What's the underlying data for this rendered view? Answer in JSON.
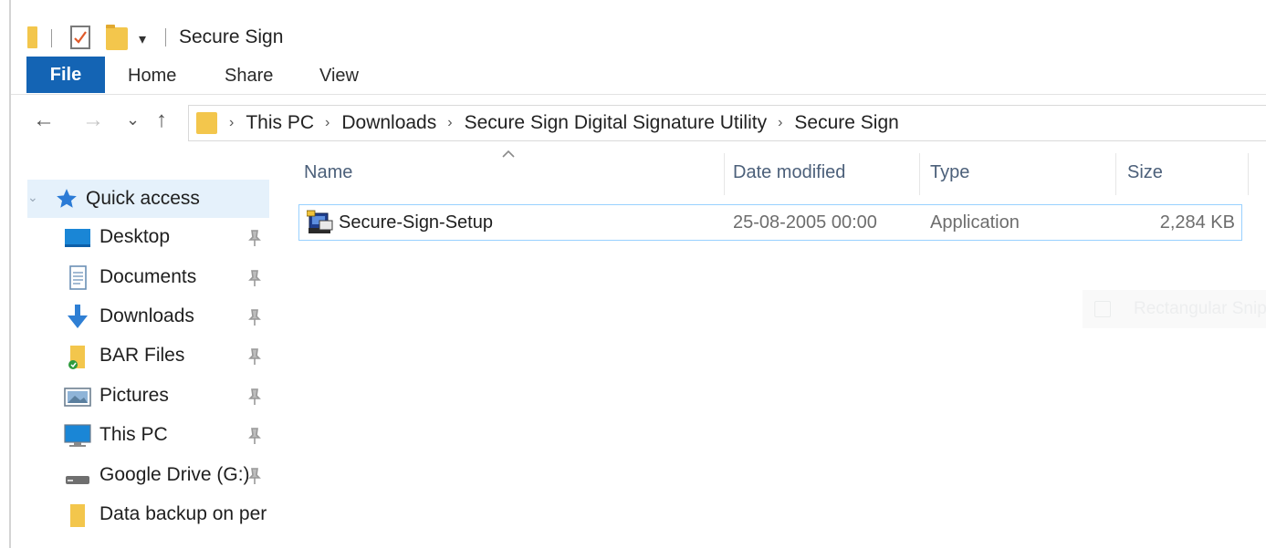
{
  "window": {
    "title": "Secure Sign"
  },
  "quick_toolbar": {
    "dropdown_glyph": "▾"
  },
  "ribbon": {
    "file_tab": "File",
    "tabs": [
      "Home",
      "Share",
      "View"
    ],
    "active_color": "#1464b4"
  },
  "nav_buttons": {
    "back": "←",
    "forward": "→",
    "recent": "⌄",
    "up": "↑"
  },
  "address": {
    "separator": "›",
    "crumbs": [
      "This PC",
      "Downloads",
      "Secure Sign  Digital Signature Utility",
      "Secure Sign"
    ]
  },
  "nav_pane": {
    "quick_access": "Quick access",
    "items": [
      {
        "label": "Desktop",
        "icon": "desktop-icon",
        "pinned": true
      },
      {
        "label": "Documents",
        "icon": "documents-icon",
        "pinned": true
      },
      {
        "label": "Downloads",
        "icon": "downloads-icon",
        "pinned": true
      },
      {
        "label": "BAR Files",
        "icon": "synced-folder-icon",
        "pinned": true
      },
      {
        "label": "Pictures",
        "icon": "pictures-icon",
        "pinned": true
      },
      {
        "label": "This PC",
        "icon": "this-pc-icon",
        "pinned": true
      },
      {
        "label": "Google Drive (G:)",
        "icon": "drive-icon",
        "pinned": true
      },
      {
        "label": "Data backup on per",
        "icon": "folder-icon",
        "pinned": false
      }
    ]
  },
  "columns": {
    "name": "Name",
    "date": "Date modified",
    "type": "Type",
    "size": "Size"
  },
  "files": [
    {
      "name": "Secure-Sign-Setup",
      "date": "25-08-2005 00:00",
      "type": "Application",
      "size": "2,284 KB",
      "icon": "installer-icon"
    }
  ],
  "ghost_tooltip": {
    "label": "Rectangular Snip"
  },
  "colors": {
    "folder": "#f3c64c",
    "selection_border": "#99d1ff",
    "selection_bg": "#e5f1fb",
    "header_text": "#4c607a"
  }
}
